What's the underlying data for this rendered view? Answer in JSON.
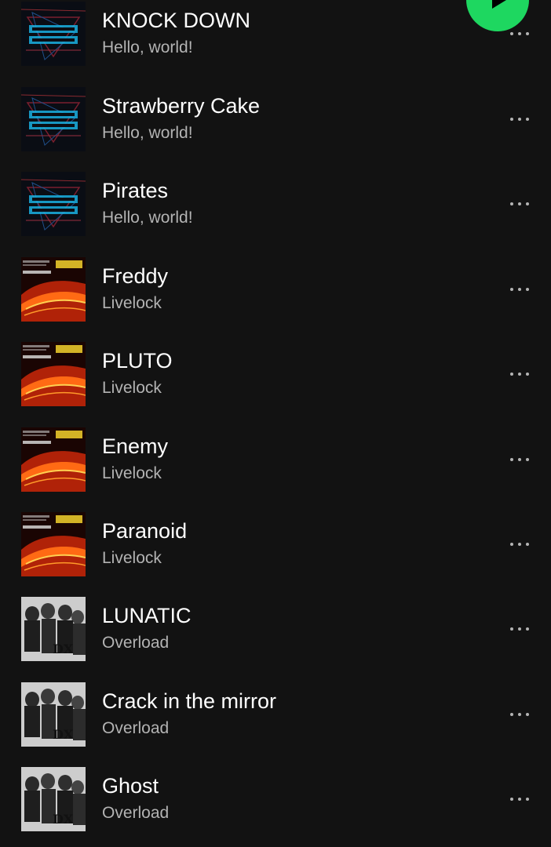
{
  "colors": {
    "background": "#121212",
    "accent": "#1ed760",
    "title": "#ffffff",
    "subtitle": "#b3b3b3"
  },
  "play_button": {
    "icon": "play-icon"
  },
  "tracks": [
    {
      "title": "KNOCK DOWN",
      "album": "Hello, world!",
      "art": "hello-world-cover"
    },
    {
      "title": "Strawberry Cake",
      "album": "Hello, world!",
      "art": "hello-world-cover"
    },
    {
      "title": "Pirates",
      "album": "Hello, world!",
      "art": "hello-world-cover"
    },
    {
      "title": "Freddy",
      "album": "Livelock",
      "art": "livelock-cover"
    },
    {
      "title": "PLUTO",
      "album": "Livelock",
      "art": "livelock-cover"
    },
    {
      "title": "Enemy",
      "album": "Livelock",
      "art": "livelock-cover"
    },
    {
      "title": "Paranoid",
      "album": "Livelock",
      "art": "livelock-cover"
    },
    {
      "title": "LUNATIC",
      "album": "Overload",
      "art": "overload-cover"
    },
    {
      "title": "Crack in the mirror",
      "album": "Overload",
      "art": "overload-cover"
    },
    {
      "title": "Ghost",
      "album": "Overload",
      "art": "overload-cover"
    }
  ],
  "more_icon": "more-options-icon"
}
